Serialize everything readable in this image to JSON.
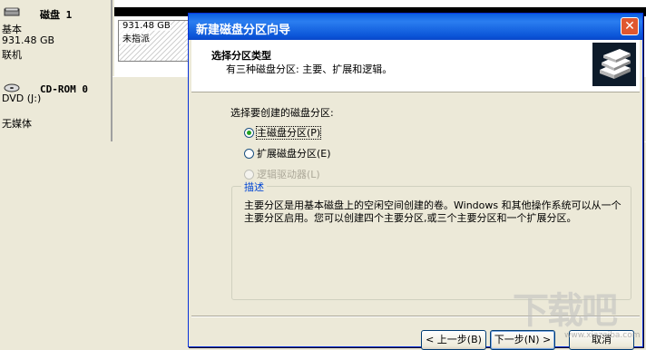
{
  "background": {
    "disk1": {
      "title": "磁盘 1",
      "type": "基本",
      "size": "931.48 GB",
      "status": "联机",
      "volume_size": "931.48 GB",
      "volume_status": "未指派"
    },
    "cdrom": {
      "title": "CD-ROM 0",
      "drive": "DVD (J:)",
      "media": "无媒体"
    }
  },
  "wizard": {
    "title": "新建磁盘分区向导",
    "close_glyph": "✕",
    "header_title": "选择分区类型",
    "header_subtitle": "有三种磁盘分区: 主要、扩展和逻辑。",
    "prompt": "选择要创建的磁盘分区:",
    "options": [
      {
        "label": "主磁盘分区(P)",
        "selected": true,
        "enabled": true
      },
      {
        "label": "扩展磁盘分区(E)",
        "selected": false,
        "enabled": true
      },
      {
        "label": "逻辑驱动器(L)",
        "selected": false,
        "enabled": false
      }
    ],
    "description_legend": "描述",
    "description_text": "主要分区是用基本磁盘上的空闲空间创建的卷。Windows 和其他操作系统可以从一个主要分区启用。您可以创建四个主要分区,或三个主要分区和一个扩展分区。",
    "buttons": {
      "back": "< 上一步(B)",
      "next": "下一步(N) >",
      "cancel": "取消"
    }
  },
  "watermark": {
    "big": "下载吧",
    "small": "www.xiazaiba.com"
  }
}
